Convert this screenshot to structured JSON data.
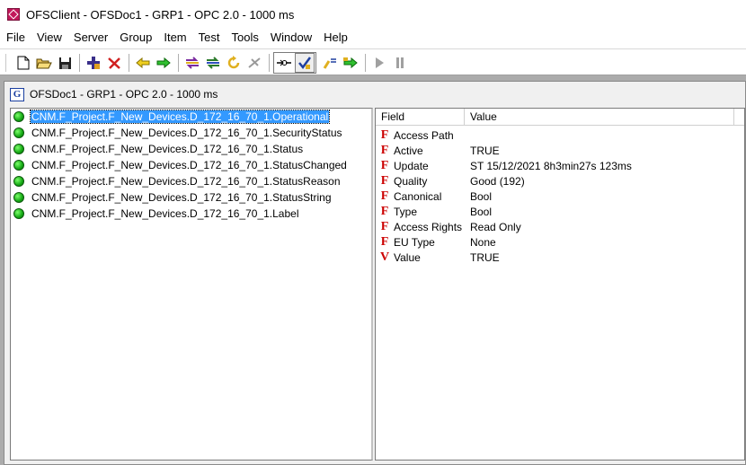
{
  "window": {
    "title": "OFSClient - OFSDoc1 - GRP1 - OPC 2.0 - 1000 ms"
  },
  "menu": [
    "File",
    "View",
    "Server",
    "Group",
    "Item",
    "Test",
    "Tools",
    "Window",
    "Help"
  ],
  "toolbar": {
    "buttons": [
      {
        "name": "new-icon"
      },
      {
        "name": "open-folder-icon"
      },
      {
        "name": "save-icon"
      },
      {
        "name": "add-item-icon"
      },
      {
        "name": "delete-icon"
      },
      {
        "name": "arrow-left-icon"
      },
      {
        "name": "arrow-right-icon"
      },
      {
        "name": "swap-icon"
      },
      {
        "name": "sync-icon"
      },
      {
        "name": "refresh-icon"
      },
      {
        "name": "disconnect-icon"
      },
      {
        "name": "connect-icon"
      },
      {
        "name": "checkmark-tool-icon"
      },
      {
        "name": "read-icon"
      },
      {
        "name": "write-icon"
      },
      {
        "name": "play-icon"
      },
      {
        "name": "pause-icon"
      }
    ]
  },
  "child_window": {
    "icon": "G",
    "title": "OFSDoc1 - GRP1 - OPC 2.0 - 1000 ms"
  },
  "items": [
    {
      "label": "CNM.F_Project.F_New_Devices.D_172_16_70_1.Operational",
      "selected": true
    },
    {
      "label": "CNM.F_Project.F_New_Devices.D_172_16_70_1.SecurityStatus",
      "selected": false
    },
    {
      "label": "CNM.F_Project.F_New_Devices.D_172_16_70_1.Status",
      "selected": false
    },
    {
      "label": "CNM.F_Project.F_New_Devices.D_172_16_70_1.StatusChanged",
      "selected": false
    },
    {
      "label": "CNM.F_Project.F_New_Devices.D_172_16_70_1.StatusReason",
      "selected": false
    },
    {
      "label": "CNM.F_Project.F_New_Devices.D_172_16_70_1.StatusString",
      "selected": false
    },
    {
      "label": "CNM.F_Project.F_New_Devices.D_172_16_70_1.Label",
      "selected": false
    }
  ],
  "properties": {
    "columns": [
      "Field",
      "Value"
    ],
    "rows": [
      {
        "icon": "F",
        "field": "Access Path",
        "value": ""
      },
      {
        "icon": "F",
        "field": "Active",
        "value": "TRUE"
      },
      {
        "icon": "F",
        "field": "Update",
        "value": "ST 15/12/2021 8h3min27s 123ms"
      },
      {
        "icon": "F",
        "field": "Quality",
        "value": "Good (192)"
      },
      {
        "icon": "F",
        "field": "Canonical",
        "value": "Bool"
      },
      {
        "icon": "F",
        "field": "Type",
        "value": "Bool"
      },
      {
        "icon": "F",
        "field": "Access Rights",
        "value": "Read Only"
      },
      {
        "icon": "F",
        "field": "EU Type",
        "value": "None"
      },
      {
        "icon": "V",
        "field": "Value",
        "value": "TRUE"
      }
    ]
  },
  "colors": {
    "selection": "#3399ff",
    "status_ok": "#14a814",
    "field_icon": "#cc0000",
    "mdi_background": "#ababab"
  }
}
